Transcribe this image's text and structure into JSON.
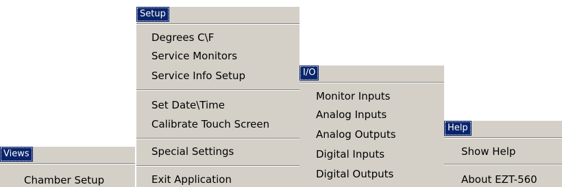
{
  "menus": {
    "views": {
      "title": "Views",
      "items": [
        "Chamber Setup"
      ]
    },
    "setup": {
      "title": "Setup",
      "items": [
        "Degrees C\\F",
        "Service Monitors",
        "Service Info Setup",
        "Set Date\\Time",
        "Calibrate Touch Screen",
        "Special Settings",
        "Exit Application"
      ]
    },
    "io": {
      "title": "I/O",
      "items": [
        "Monitor Inputs",
        "Analog Inputs",
        "Analog Outputs",
        "Digital Inputs",
        "Digital Outputs"
      ]
    },
    "help": {
      "title": "Help",
      "items": [
        "Show Help",
        "About EZT-560"
      ]
    }
  },
  "colors": {
    "menu_bg": "#d4d0c8",
    "title_bg": "#0a246a",
    "title_text": "#ffffff",
    "separator_dark": "#808080",
    "separator_light": "#ffffff"
  }
}
